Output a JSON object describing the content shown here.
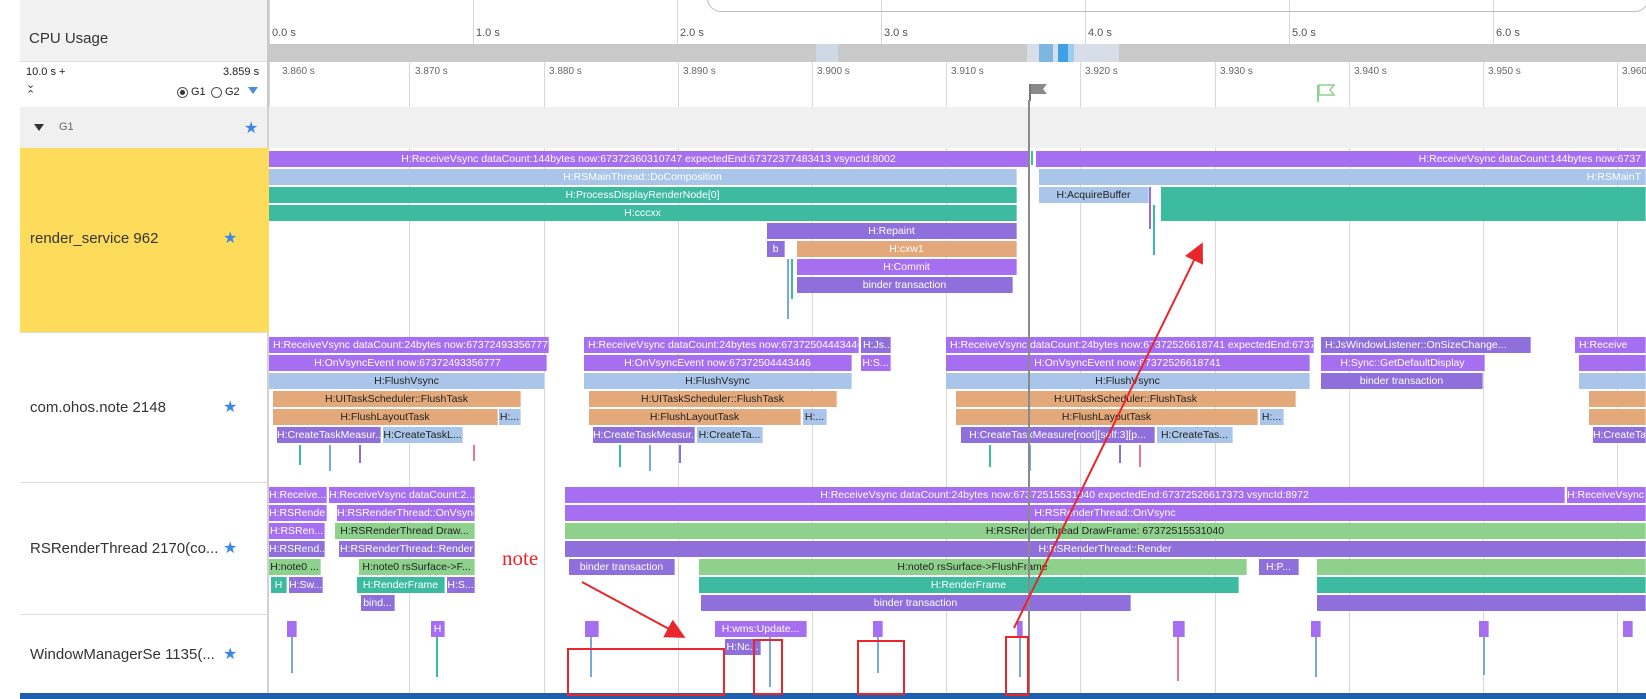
{
  "cpu_usage_label": "CPU Usage",
  "overview_ticks": [
    "0.0 s",
    "1.0 s",
    "2.0 s",
    "3.0 s",
    "4.0 s",
    "5.0 s",
    "6.0 s"
  ],
  "range": {
    "span": "10.0 s +",
    "offset": "3.859 s"
  },
  "group_radio": {
    "g1": "G1",
    "g2": "G2",
    "selected": "G1"
  },
  "detail_ticks": [
    "3.860 s",
    "3.870 s",
    "3.880 s",
    "3.890 s",
    "3.900 s",
    "3.910 s",
    "3.920 s",
    "3.930 s",
    "3.940 s",
    "3.950 s",
    "3.960"
  ],
  "group_row_label": "G1",
  "rows": [
    {
      "name": "render_service 962",
      "highlight": "#fddc5c"
    },
    {
      "name": "com.ohos.note 2148"
    },
    {
      "name": "RSRenderThread 2170(co..."
    },
    {
      "name": "WindowManagerSe 1135(..."
    }
  ],
  "slices": {
    "rs": {
      "receive_vsync_1": "H:ReceiveVsync dataCount:144bytes now:67372360310747 expectedEnd:67372377483413 vsyncId:8002",
      "receive_vsync_2": "H:ReceiveVsync dataCount:144bytes now:6737",
      "do_composition": "H:RSMainThread::DoComposition",
      "do_composition_2": "H:RSMainT",
      "process_display": "H:ProcessDisplayRenderNode[0]",
      "cccxx": "H:cccxx",
      "acquire_buffer": "H:AcquireBuffer",
      "repaint": "H:Repaint",
      "b": "b",
      "cxw1": "H:cxw1",
      "commit": "H:Commit",
      "binder": "binder transaction"
    },
    "note": {
      "rv_a": "H:ReceiveVsync dataCount:24bytes now:67372493356777 e...",
      "rv_b": "H:ReceiveVsync dataCount:24bytes now:67372504443446...",
      "rv_b2": "H:Js...",
      "rv_c": "H:ReceiveVsync dataCount:24bytes now:67372526618741 expectedEnd:6737253...",
      "js_window": "H:JsWindowListener::OnSizeChange...",
      "rv_d": "H:Receive",
      "onvsync_a": "H:OnVsyncEvent now:67372493356777",
      "onvsync_b": "H:OnVsyncEvent now:67372504443446",
      "onvsync_b2": "H:S...",
      "onvsync_c": "H:OnVsyncEvent now:67372526618741",
      "sync_display": "H:Sync::GetDefaultDisplay",
      "flush_vsync": "H:FlushVsync",
      "binder": "binder transaction",
      "flush_task": "H:UITaskScheduler::FlushTask",
      "flush_layout": "H:FlushLayoutTask",
      "h_dots": "H:...",
      "ctm_a": "H:CreateTaskMeasur...",
      "ctl_a": "H:CreateTaskL...",
      "ctm_b": "H:CreateTaskMeasur...",
      "ctl_b": "H:CreateTa...",
      "ctm_c": "H:CreateTaskMeasure[root][self:3][p...",
      "ctl_c": "H:CreateTas...",
      "ctm_d": "H:CreateTa"
    },
    "rsrt": {
      "receive_a": "H:Receive...",
      "receive_b": "H:ReceiveVsync dataCount:2...",
      "receive_big": "H:ReceiveVsync dataCount:24bytes now:67372515531040 expectedEnd:67372526617373 vsyncId:8972",
      "receive_end": "H:ReceiveVsync dat",
      "rsrende_a": "H:RSRende...",
      "onvsync_b": "H:RSRenderThread::OnVsync",
      "onvsync_big": "H:RSRenderThread::OnVsync",
      "rsren_a": "H:RSRen...",
      "draw_b": "H:RSRenderThread Draw...",
      "draw_big": "H:RSRenderThread DrawFrame: 67372515531040",
      "rsrend_a": "H:RSRend...",
      "render_b": "H:RSRenderThread::Render",
      "render_big": "H:RSRenderThread::Render",
      "note0_a": "H:note0 ...",
      "note0_b": "H:note0 rsSurface->F...",
      "binder_big": "binder transaction",
      "note0_big": "H:note0 rsSurface->FlushFrame",
      "hp": "H:P...",
      "h": "H",
      "hsw": "H:Sw...",
      "renderframe_b": "H:RenderFrame",
      "hs": "H:S...",
      "renderframe_big": "H:RenderFrame",
      "bind": "bind...",
      "binder_big2": "binder transaction"
    },
    "wms": {
      "h": "H",
      "update": "H:wms:Update...",
      "hnc": "H:Nc..."
    }
  },
  "annotation": {
    "text": "note",
    "color": "#e8262b"
  }
}
